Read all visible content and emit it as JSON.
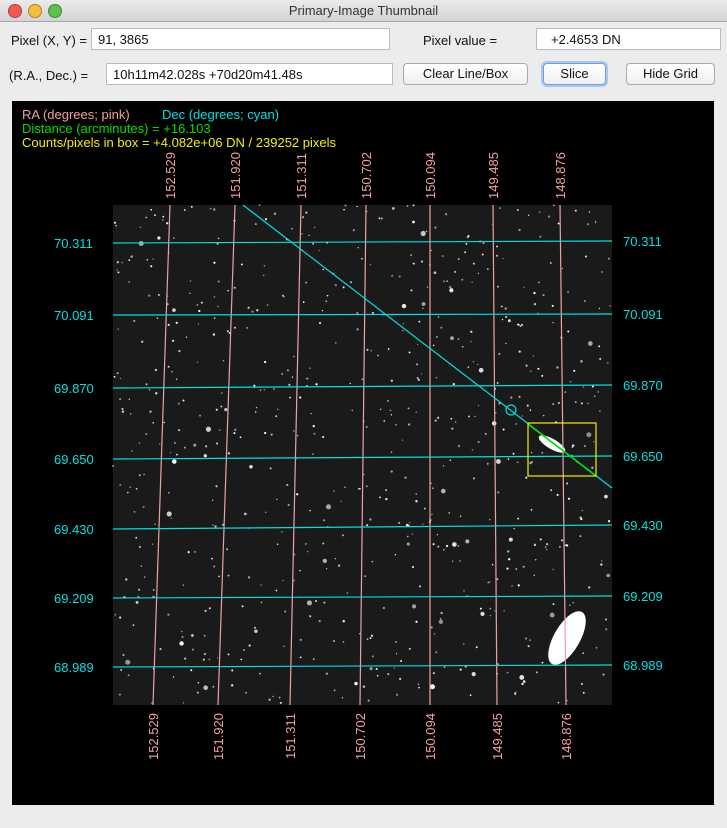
{
  "window": {
    "title": "Primary-Image Thumbnail"
  },
  "fields": {
    "pixel_label": "Pixel (X, Y) =",
    "pixel_value": "91, 3865",
    "pixval_label": "Pixel value =",
    "pixval_value": "+2.4653 DN",
    "radec_label": "(R.A., Dec.) =",
    "radec_value": "10h11m42.028s +70d20m41.48s"
  },
  "buttons": {
    "clear": "Clear Line/Box",
    "slice": "Slice",
    "hide_grid": "Hide Grid"
  },
  "overlay": {
    "ra_legend": "RA (degrees; pink)",
    "dec_legend": "Dec (degrees; cyan)",
    "distance": "Distance (arcminutes) = +16.103",
    "counts": "Counts/pixels in box = +4.082e+06 DN / 239252 pixels"
  },
  "grid": {
    "ra_labels": [
      "152.529",
      "151.920",
      "151.311",
      "150.702",
      "150.094",
      "149.485",
      "148.876"
    ],
    "dec_labels": [
      "70.311",
      "70.091",
      "69.870",
      "69.650",
      "69.430",
      "69.209",
      "68.989"
    ]
  },
  "colors": {
    "ra": "#f0a0a0",
    "dec": "#00e0e0",
    "distance": "#00e000",
    "counts": "#f0f000"
  }
}
